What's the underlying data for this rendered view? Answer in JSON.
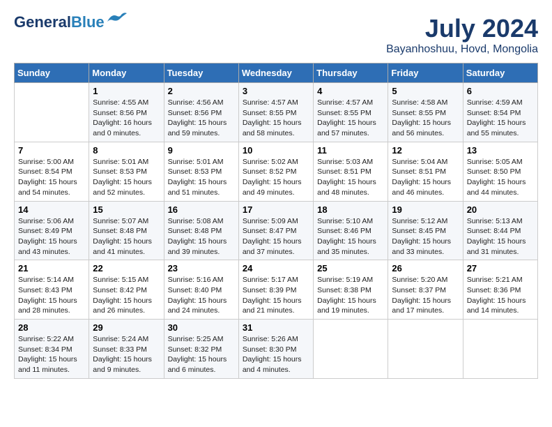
{
  "header": {
    "logo_line1": "General",
    "logo_line2": "Blue",
    "month": "July 2024",
    "location": "Bayanhoshuu, Hovd, Mongolia"
  },
  "weekdays": [
    "Sunday",
    "Monday",
    "Tuesday",
    "Wednesday",
    "Thursday",
    "Friday",
    "Saturday"
  ],
  "weeks": [
    [
      {
        "day": "",
        "content": ""
      },
      {
        "day": "1",
        "content": "Sunrise: 4:55 AM\nSunset: 8:56 PM\nDaylight: 16 hours\nand 0 minutes."
      },
      {
        "day": "2",
        "content": "Sunrise: 4:56 AM\nSunset: 8:56 PM\nDaylight: 15 hours\nand 59 minutes."
      },
      {
        "day": "3",
        "content": "Sunrise: 4:57 AM\nSunset: 8:55 PM\nDaylight: 15 hours\nand 58 minutes."
      },
      {
        "day": "4",
        "content": "Sunrise: 4:57 AM\nSunset: 8:55 PM\nDaylight: 15 hours\nand 57 minutes."
      },
      {
        "day": "5",
        "content": "Sunrise: 4:58 AM\nSunset: 8:55 PM\nDaylight: 15 hours\nand 56 minutes."
      },
      {
        "day": "6",
        "content": "Sunrise: 4:59 AM\nSunset: 8:54 PM\nDaylight: 15 hours\nand 55 minutes."
      }
    ],
    [
      {
        "day": "7",
        "content": "Sunrise: 5:00 AM\nSunset: 8:54 PM\nDaylight: 15 hours\nand 54 minutes."
      },
      {
        "day": "8",
        "content": "Sunrise: 5:01 AM\nSunset: 8:53 PM\nDaylight: 15 hours\nand 52 minutes."
      },
      {
        "day": "9",
        "content": "Sunrise: 5:01 AM\nSunset: 8:53 PM\nDaylight: 15 hours\nand 51 minutes."
      },
      {
        "day": "10",
        "content": "Sunrise: 5:02 AM\nSunset: 8:52 PM\nDaylight: 15 hours\nand 49 minutes."
      },
      {
        "day": "11",
        "content": "Sunrise: 5:03 AM\nSunset: 8:51 PM\nDaylight: 15 hours\nand 48 minutes."
      },
      {
        "day": "12",
        "content": "Sunrise: 5:04 AM\nSunset: 8:51 PM\nDaylight: 15 hours\nand 46 minutes."
      },
      {
        "day": "13",
        "content": "Sunrise: 5:05 AM\nSunset: 8:50 PM\nDaylight: 15 hours\nand 44 minutes."
      }
    ],
    [
      {
        "day": "14",
        "content": "Sunrise: 5:06 AM\nSunset: 8:49 PM\nDaylight: 15 hours\nand 43 minutes."
      },
      {
        "day": "15",
        "content": "Sunrise: 5:07 AM\nSunset: 8:48 PM\nDaylight: 15 hours\nand 41 minutes."
      },
      {
        "day": "16",
        "content": "Sunrise: 5:08 AM\nSunset: 8:48 PM\nDaylight: 15 hours\nand 39 minutes."
      },
      {
        "day": "17",
        "content": "Sunrise: 5:09 AM\nSunset: 8:47 PM\nDaylight: 15 hours\nand 37 minutes."
      },
      {
        "day": "18",
        "content": "Sunrise: 5:10 AM\nSunset: 8:46 PM\nDaylight: 15 hours\nand 35 minutes."
      },
      {
        "day": "19",
        "content": "Sunrise: 5:12 AM\nSunset: 8:45 PM\nDaylight: 15 hours\nand 33 minutes."
      },
      {
        "day": "20",
        "content": "Sunrise: 5:13 AM\nSunset: 8:44 PM\nDaylight: 15 hours\nand 31 minutes."
      }
    ],
    [
      {
        "day": "21",
        "content": "Sunrise: 5:14 AM\nSunset: 8:43 PM\nDaylight: 15 hours\nand 28 minutes."
      },
      {
        "day": "22",
        "content": "Sunrise: 5:15 AM\nSunset: 8:42 PM\nDaylight: 15 hours\nand 26 minutes."
      },
      {
        "day": "23",
        "content": "Sunrise: 5:16 AM\nSunset: 8:40 PM\nDaylight: 15 hours\nand 24 minutes."
      },
      {
        "day": "24",
        "content": "Sunrise: 5:17 AM\nSunset: 8:39 PM\nDaylight: 15 hours\nand 21 minutes."
      },
      {
        "day": "25",
        "content": "Sunrise: 5:19 AM\nSunset: 8:38 PM\nDaylight: 15 hours\nand 19 minutes."
      },
      {
        "day": "26",
        "content": "Sunrise: 5:20 AM\nSunset: 8:37 PM\nDaylight: 15 hours\nand 17 minutes."
      },
      {
        "day": "27",
        "content": "Sunrise: 5:21 AM\nSunset: 8:36 PM\nDaylight: 15 hours\nand 14 minutes."
      }
    ],
    [
      {
        "day": "28",
        "content": "Sunrise: 5:22 AM\nSunset: 8:34 PM\nDaylight: 15 hours\nand 11 minutes."
      },
      {
        "day": "29",
        "content": "Sunrise: 5:24 AM\nSunset: 8:33 PM\nDaylight: 15 hours\nand 9 minutes."
      },
      {
        "day": "30",
        "content": "Sunrise: 5:25 AM\nSunset: 8:32 PM\nDaylight: 15 hours\nand 6 minutes."
      },
      {
        "day": "31",
        "content": "Sunrise: 5:26 AM\nSunset: 8:30 PM\nDaylight: 15 hours\nand 4 minutes."
      },
      {
        "day": "",
        "content": ""
      },
      {
        "day": "",
        "content": ""
      },
      {
        "day": "",
        "content": ""
      }
    ]
  ]
}
